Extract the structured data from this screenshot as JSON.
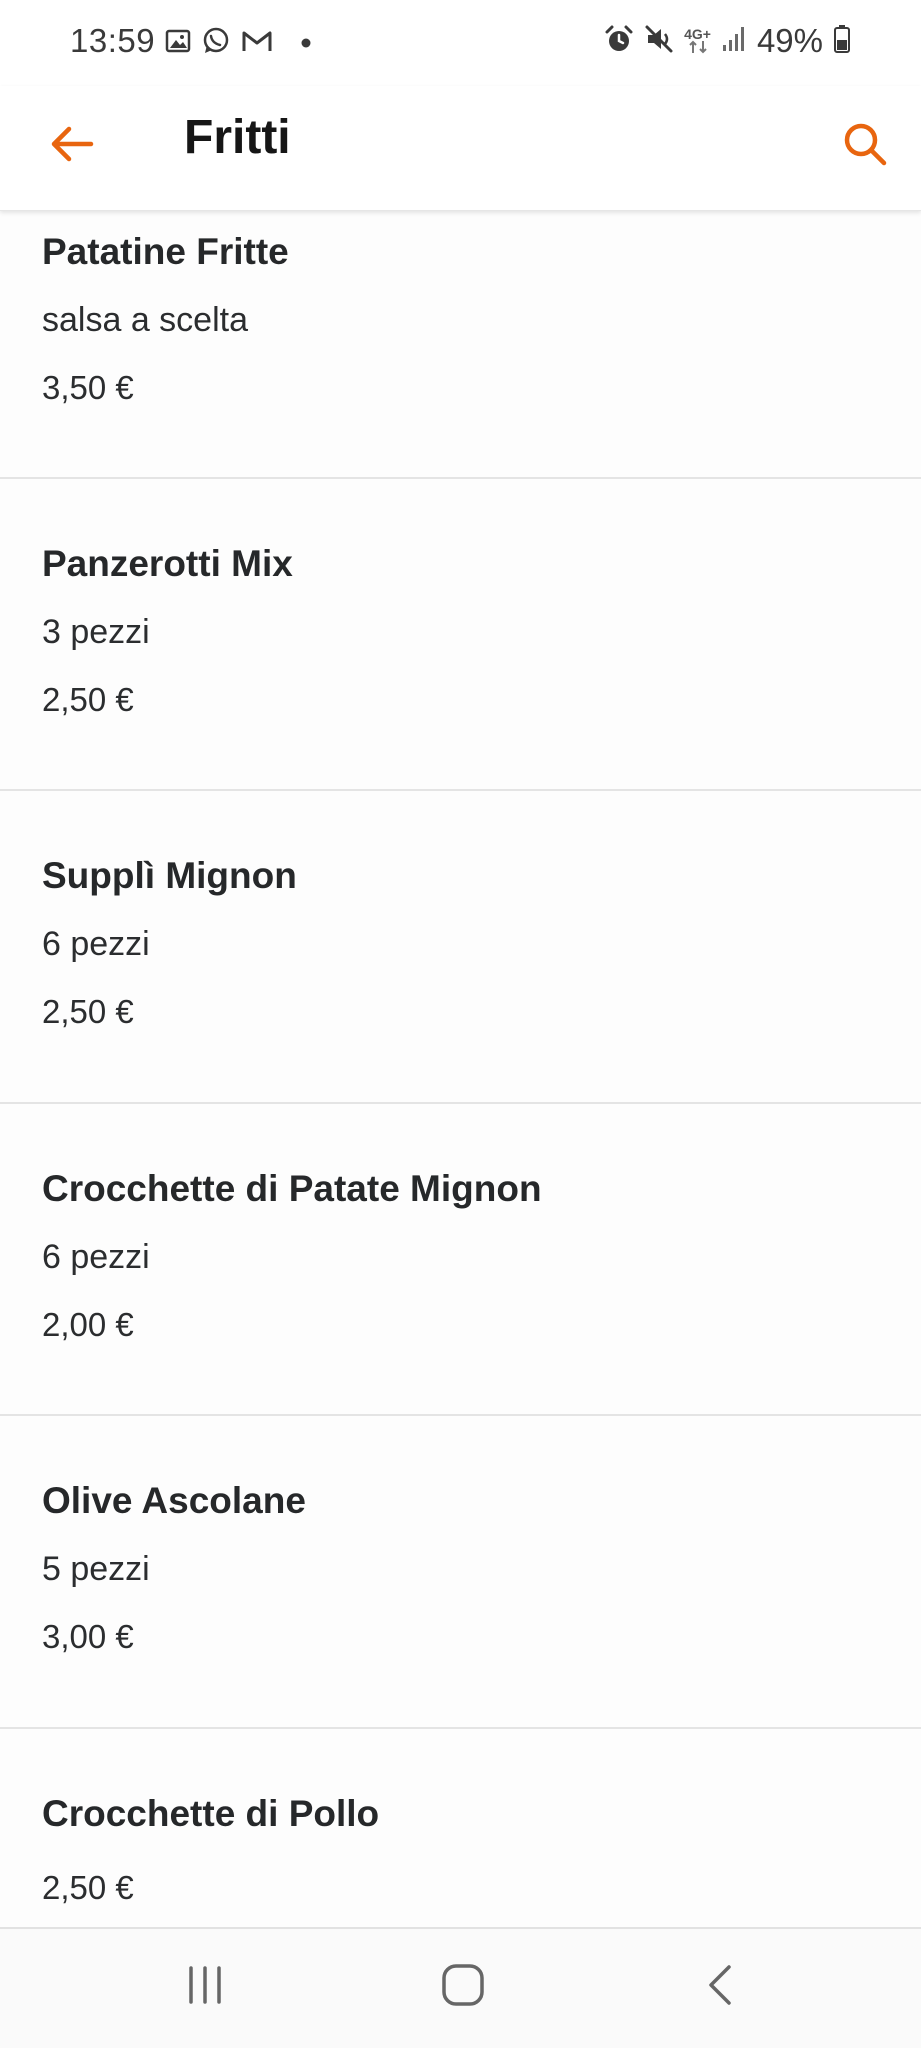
{
  "status_bar": {
    "time": "13:59",
    "left_icons": [
      "image-icon",
      "whatsapp-icon",
      "gmail-icon",
      "dot-icon"
    ],
    "right_icons": [
      "alarm-icon",
      "mute-icon",
      "network-4g-icon",
      "signal-icon",
      "battery-icon"
    ],
    "network_label": "4G+",
    "battery": "49%"
  },
  "app_bar": {
    "title": "Fritti",
    "back_icon": "arrow-left-icon",
    "search_icon": "search-icon"
  },
  "colors": {
    "accent": "#e8650f",
    "text": "#26282a",
    "divider": "#e4e4e4",
    "background": "#fdfdfd"
  },
  "items": [
    {
      "name": "Patatine Fritte",
      "description": "salsa a scelta",
      "price": "3,50 €"
    },
    {
      "name": "Panzerotti Mix",
      "description": "3 pezzi",
      "price": "2,50 €"
    },
    {
      "name": "Supplì Mignon",
      "description": "6 pezzi",
      "price": "2,50 €"
    },
    {
      "name": "Crocchette di Patate Mignon",
      "description": "6 pezzi",
      "price": "2,00 €"
    },
    {
      "name": "Olive Ascolane",
      "description": "5 pezzi",
      "price": "3,00 €"
    },
    {
      "name": "Crocchette di Pollo",
      "price": "2,50 €"
    }
  ],
  "nav_bar": {
    "buttons": [
      "recent-apps-icon",
      "home-icon",
      "back-icon"
    ]
  }
}
